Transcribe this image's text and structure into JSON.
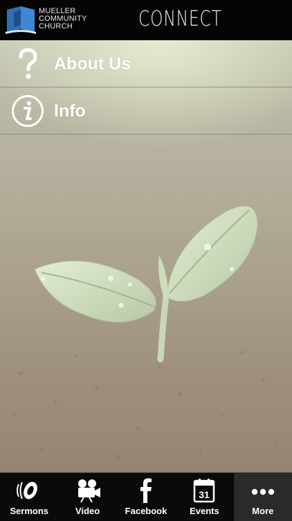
{
  "header": {
    "logo_lines": [
      "MUELLER",
      "COMMUNITY",
      "CHURCH"
    ],
    "logo_icon": "church-book-logo-icon",
    "title": "CONNECT"
  },
  "menu": {
    "items": [
      {
        "label": "About Us",
        "icon": "question-mark-icon"
      },
      {
        "label": "Info",
        "icon": "info-circle-icon"
      }
    ]
  },
  "tabs": [
    {
      "label": "Sermons",
      "icon": "microphone-sound-icon"
    },
    {
      "label": "Video",
      "icon": "video-camera-icon"
    },
    {
      "label": "Facebook",
      "icon": "facebook-icon"
    },
    {
      "label": "Events",
      "icon": "calendar-icon",
      "badge": "31"
    },
    {
      "label": "More",
      "icon": "more-dots-icon",
      "active": true
    }
  ],
  "colors": {
    "header_bg": "#050505",
    "logo_blue": "#2f6fb8",
    "tabbar_bg": "#0a0a0a",
    "tab_active_bg": "#2a2a2a",
    "text": "#ffffff"
  }
}
